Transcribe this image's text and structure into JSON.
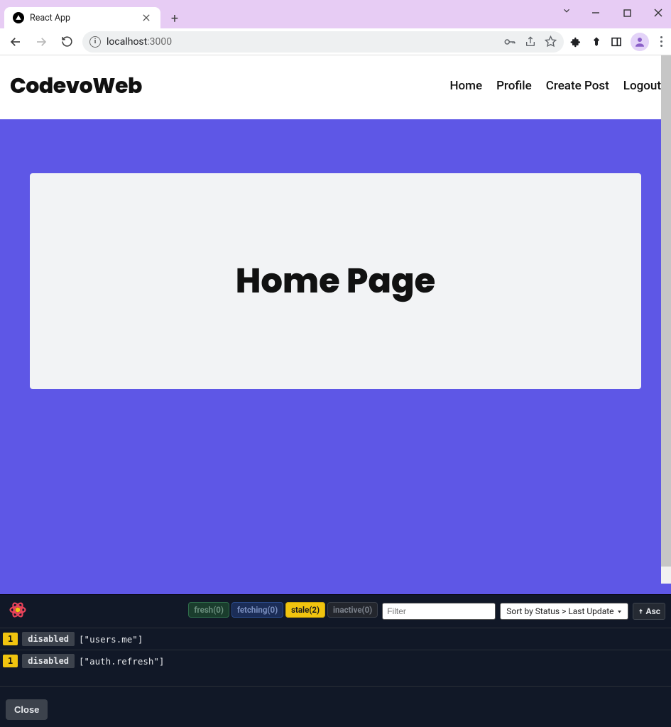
{
  "browser": {
    "tab_title": "React App",
    "address_host": "localhost",
    "address_path": ":3000"
  },
  "app": {
    "brand": "CodevoWeb",
    "nav": [
      "Home",
      "Profile",
      "Create Post",
      "Logout"
    ],
    "hero_title": "Home Page"
  },
  "devtools": {
    "pills": {
      "fresh": {
        "label": "fresh",
        "count": 0
      },
      "fetching": {
        "label": "fetching",
        "count": 0
      },
      "stale": {
        "label": "stale",
        "count": 2
      },
      "inactive": {
        "label": "inactive",
        "count": 0
      }
    },
    "filter_placeholder": "Filter",
    "sort_label": "Sort by Status > Last Update",
    "asc_label": "Asc",
    "queries": [
      {
        "count": 1,
        "status": "disabled",
        "key": "[\"users.me\"]"
      },
      {
        "count": 1,
        "status": "disabled",
        "key": "[\"auth.refresh\"]"
      }
    ],
    "close_label": "Close"
  }
}
